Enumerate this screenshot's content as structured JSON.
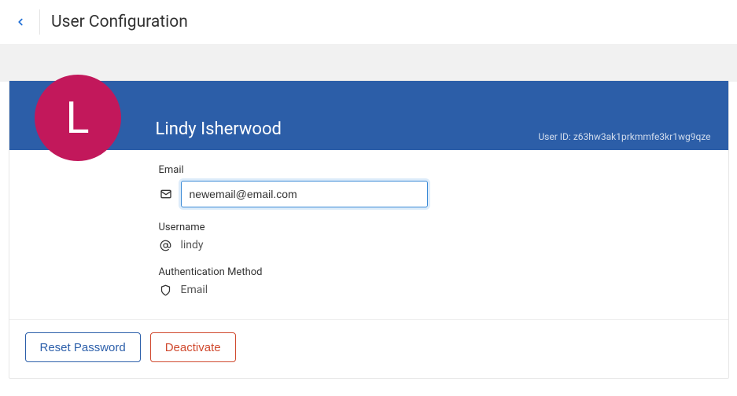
{
  "header": {
    "title": "User Configuration"
  },
  "user": {
    "avatar_initial": "L",
    "display_name": "Lindy Isherwood",
    "user_id_label": "User ID:",
    "user_id": "z63hw3ak1prkmmfe3kr1wg9qze"
  },
  "fields": {
    "email": {
      "label": "Email",
      "value": "newemail@email.com"
    },
    "username": {
      "label": "Username",
      "value": "lindy"
    },
    "auth_method": {
      "label": "Authentication Method",
      "value": "Email"
    }
  },
  "actions": {
    "reset_password": "Reset Password",
    "deactivate": "Deactivate"
  }
}
